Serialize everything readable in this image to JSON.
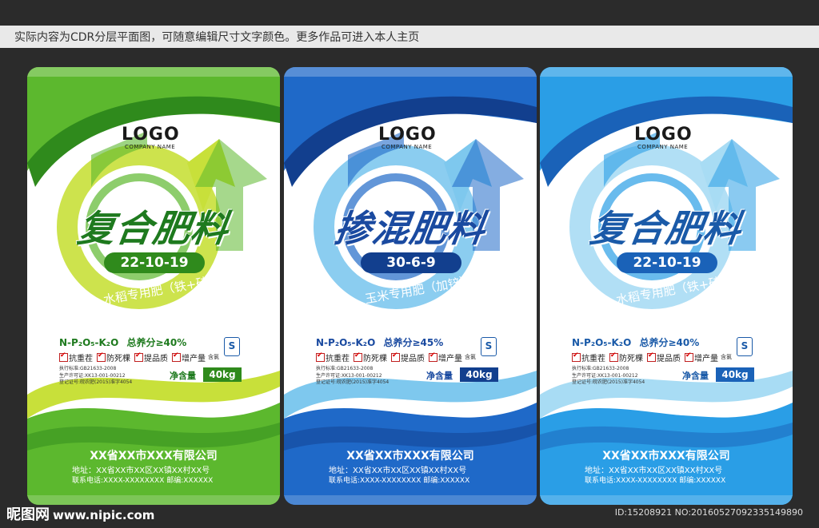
{
  "banner": "实际内容为CDR分层平面图，可随意编辑尺寸文字颜色。更多作品可进入本人主页",
  "common": {
    "logo": "LOGO",
    "company_name_small": "COMPANY NAME",
    "quality_mark": "S",
    "hanlv": "含氯",
    "spec_line1": "执行标准:GB21633-2008",
    "spec_line2": "生产许可证:XK13-001-00212",
    "spec_line3": "登记证号:皖农肥(2015)准字4054",
    "net_label": "净含量",
    "net_value": "40kg",
    "company": "XX省XX市XXX有限公司",
    "address": "地址：XX省XX市XX区XX镇XX村XX号",
    "phone": "联系电话:XXXX-XXXXXXXX  邮编:XXXXXX",
    "features": [
      "抗重茬",
      "防死棵",
      "提品质",
      "增产量"
    ]
  },
  "bags": [
    {
      "title": "复合肥料",
      "code": "22-10-19",
      "usage": "水稻专用肥（铁+硅）",
      "formula_prefix": "N-P₂O₅-K₂O",
      "formula_total": "总养分≥40%",
      "colors": {
        "main": "#5cb82e",
        "dark": "#2f8a1c",
        "light": "#c8e03a",
        "accent": "#1e7a1e"
      }
    },
    {
      "title": "掺混肥料",
      "code": "30-6-9",
      "usage": "玉米专用肥（加锌）",
      "formula_prefix": "N-P₂O₅-K₂O",
      "formula_total": "总养分≥45%",
      "colors": {
        "main": "#1f69c8",
        "dark": "#123f8e",
        "light": "#7ec8ee",
        "accent": "#1a4aa0"
      }
    },
    {
      "title": "复合肥料",
      "code": "22-10-19",
      "usage": "水稻专用肥（铁+硅）",
      "formula_prefix": "N-P₂O₅-K₂O",
      "formula_total": "总养分≥40%",
      "colors": {
        "main": "#2a9ee6",
        "dark": "#1a62b8",
        "light": "#a8dcf4",
        "accent": "#1a5aa8"
      }
    }
  ],
  "footer": {
    "brand": "昵图网",
    "site": "www.nipic.com",
    "id": "ID:15208921 NO:20160527092335149890"
  }
}
